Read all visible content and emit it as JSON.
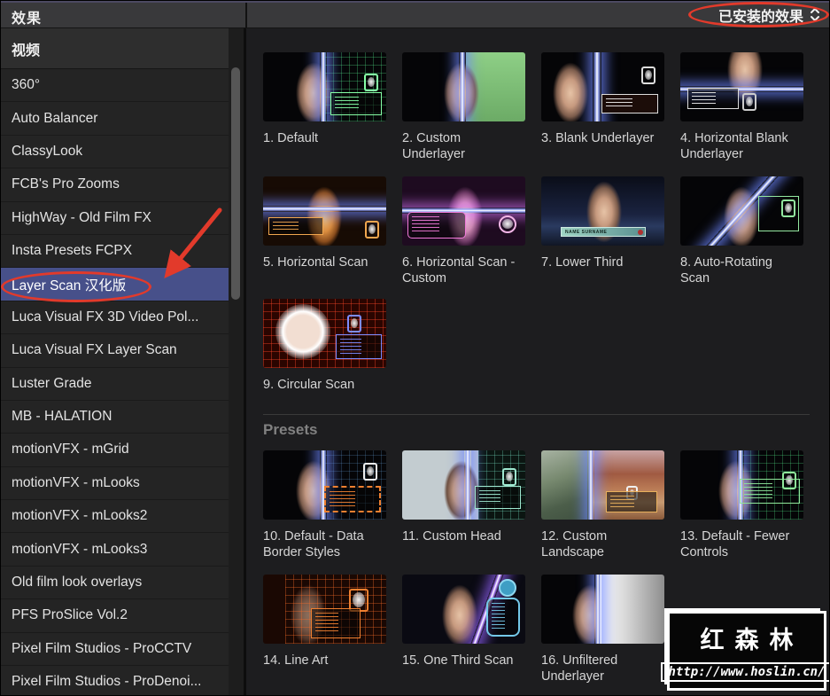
{
  "header": {
    "title": "效果",
    "filter_label": "已安装的效果"
  },
  "icons": {
    "dropdown_chevron": "chevron-up-down-icon",
    "thumbnail_badge": "fingerprint-icon"
  },
  "sidebar": {
    "section": "视频",
    "selected_item": "Layer Scan 汉化版",
    "items": [
      "360°",
      "Auto Balancer",
      "ClassyLook",
      "FCB's Pro Zooms",
      "HighWay - Old Film FX",
      "Insta Presets FCPX",
      "Layer Scan 汉化版",
      "Luca Visual FX 3D Video Pol...",
      "Luca Visual FX Layer Scan",
      "Luster Grade",
      "MB - HALATION",
      "motionVFX - mGrid",
      "motionVFX - mLooks",
      "motionVFX - mLooks2",
      "motionVFX - mLooks3",
      "Old film look overlays",
      "PFS ProSlice Vol.2",
      "Pixel Film Studios - ProCCTV",
      "Pixel Film Studios - ProDenoi..."
    ]
  },
  "effects": {
    "items": [
      {
        "label": "1. Default"
      },
      {
        "label": "2. Custom Underlayer"
      },
      {
        "label": "3. Blank Underlayer"
      },
      {
        "label": "4. Horizontal Blank Underlayer"
      },
      {
        "label": "5. Horizontal Scan"
      },
      {
        "label": "6. Horizontal Scan - Custom"
      },
      {
        "label": "7. Lower Third"
      },
      {
        "label": "8. Auto-Rotating Scan"
      },
      {
        "label": "9. Circular Scan"
      }
    ],
    "presets_header": "Presets",
    "presets": [
      {
        "label": "10. Default - Data Border Styles"
      },
      {
        "label": "11. Custom Head"
      },
      {
        "label": "12. Custom Landscape"
      },
      {
        "label": "13. Default - Fewer Controls"
      },
      {
        "label": "14. Line Art"
      },
      {
        "label": "15. One Third Scan"
      },
      {
        "label": "16. Unfiltered Underlayer"
      }
    ]
  },
  "misc": {
    "lower_third_text": "NAME SURNAME"
  },
  "annotations": {
    "color": "#e23a2b",
    "circled": [
      "已安装的效果",
      "Layer Scan 汉化版"
    ]
  },
  "watermark": {
    "title": "红森林",
    "url": "http://www.hoslin.cn/"
  },
  "colors": {
    "selection": "#47508a",
    "topbar": "#39393b",
    "sidebar_row": "#242424",
    "main_bg": "#1d1d1f"
  }
}
